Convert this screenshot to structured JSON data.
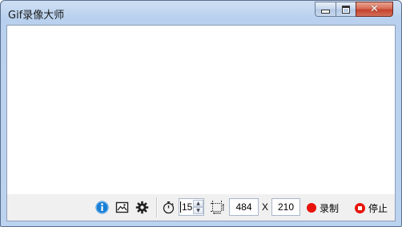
{
  "window": {
    "title": "Gif录像大师",
    "controls": {
      "minimize": "minimize",
      "maximize": "maximize",
      "close": "close"
    }
  },
  "toolbar": {
    "icons": {
      "info": "info-icon",
      "image": "image-icon",
      "settings": "gear-icon",
      "timer": "stopwatch-icon",
      "region": "region-select-icon"
    },
    "frame_rate": "15",
    "width": "484",
    "separator_x": "X",
    "height": "210",
    "record_label": "录制",
    "stop_label": "停止"
  },
  "colors": {
    "record_red": "#e8140c",
    "info_blue": "#1a7fd4"
  }
}
